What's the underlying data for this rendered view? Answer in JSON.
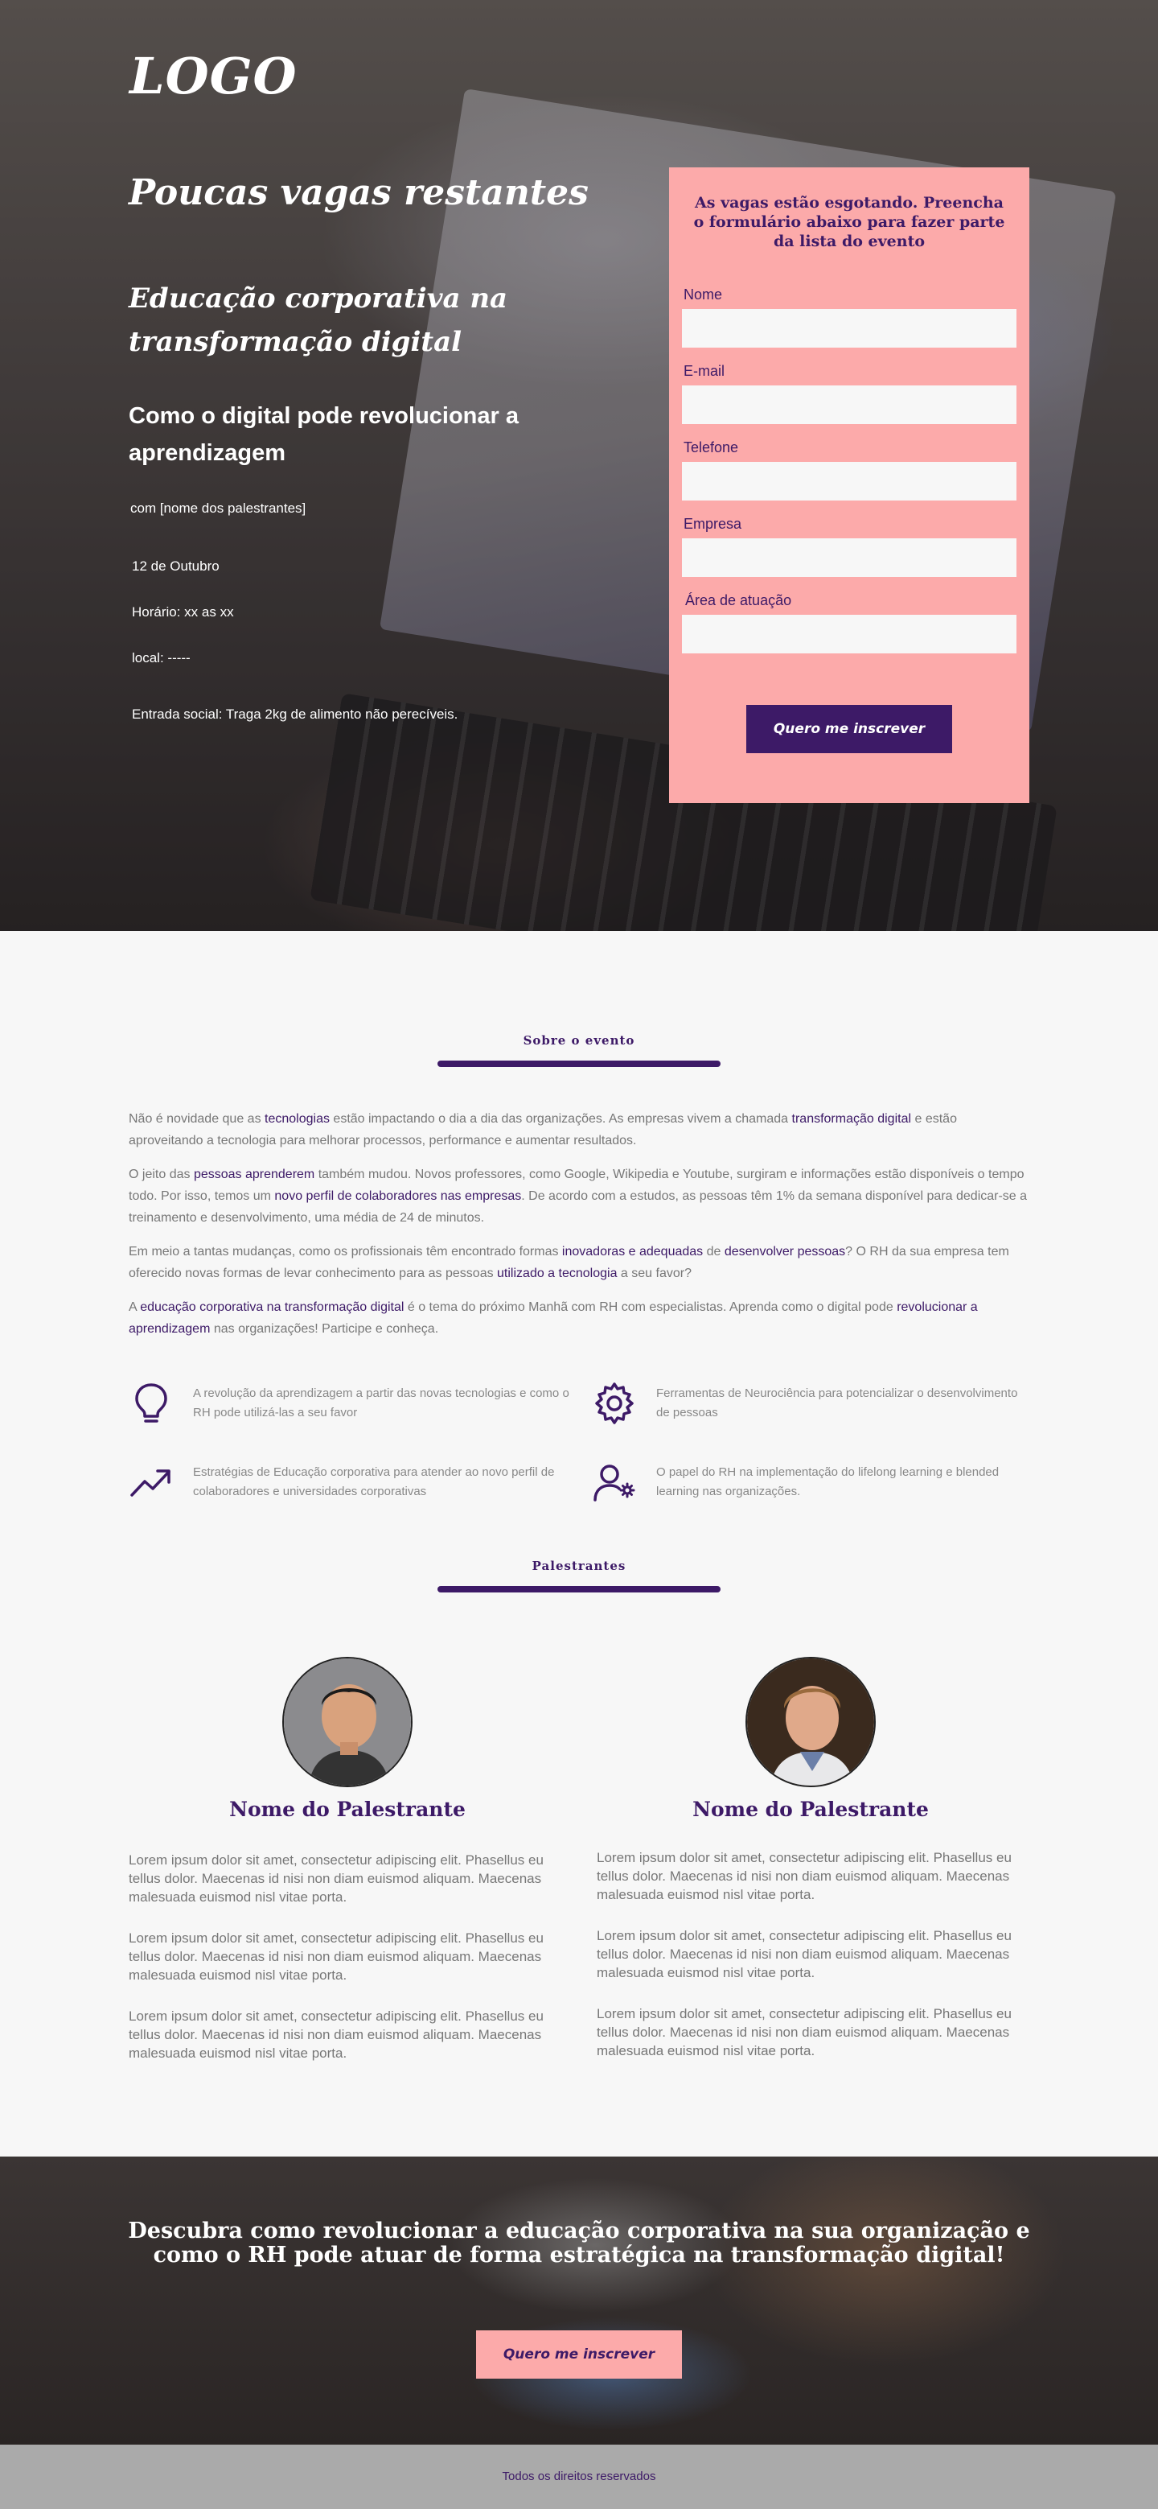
{
  "colors": {
    "primary": "#3d1a67",
    "accent": "#fcaaaa",
    "background": "#f7f7f7",
    "footer": "#aaaaaa"
  },
  "hero": {
    "logo": "LOGO",
    "title": "Poucas vagas restantes",
    "subtitle": "Educação corporativa na transformação digital",
    "subtitle2": "Como o digital pode revolucionar a aprendizagem",
    "speakers_line": "com [nome dos palestrantes]",
    "date": "12 de Outubro",
    "time": "Horário: xx as xx",
    "location": "local: -----",
    "entry": "Entrada social: Traga 2kg de alimento não perecíveis."
  },
  "form": {
    "title": "As vagas estão esgotando. Preencha o formulário abaixo para fazer parte da lista do evento",
    "fields": [
      {
        "label": "Nome",
        "value": ""
      },
      {
        "label": "E-mail",
        "value": ""
      },
      {
        "label": "Telefone",
        "value": ""
      },
      {
        "label": "Empresa",
        "value": ""
      },
      {
        "label": "Área de atuação",
        "value": ""
      }
    ],
    "submit": "Quero me inscrever"
  },
  "about": {
    "title": "Sobre o evento",
    "p1": [
      "Não é novidade que as ",
      "tecnologias",
      " estão impactando o dia a dia das organizações. As empresas vivem a chamada ",
      "transformação digital",
      " e estão aproveitando a tecnologia para melhorar processos, performance e aumentar resultados."
    ],
    "p2": [
      "O jeito das ",
      "pessoas aprenderem",
      " também mudou. Novos professores, como Google, Wikipedia e Youtube, surgiram e informações estão disponíveis o tempo todo. Por isso, temos um ",
      "novo perfil de colaboradores nas empresas",
      ". De acordo com a estudos, as pessoas têm 1% da semana disponível para dedicar-se a treinamento e desenvolvimento, uma média de 24 de minutos."
    ],
    "p3": [
      "Em meio a tantas mudanças, como os profissionais têm encontrado formas ",
      "inovadoras e adequadas",
      " de ",
      "desenvolver pessoas",
      "? O RH da sua empresa tem oferecido novas formas de levar conhecimento para as pessoas ",
      "utilizado a tecnologia",
      " a seu favor?"
    ],
    "p4": [
      "A ",
      "educação corporativa na transformação digital",
      " é o tema do próximo Manhã com RH com especialistas. Aprenda como o digital pode ",
      "revolucionar a aprendizagem",
      " nas organizações! Participe e conheça."
    ],
    "features": [
      {
        "icon": "lightbulb-icon",
        "text": "A revolução da aprendizagem a partir das novas tecnologias e como o RH pode utilizá-las a seu favor"
      },
      {
        "icon": "gear-icon",
        "text": "Ferramentas de Neurociência para potencializar o desenvolvimento de pessoas"
      },
      {
        "icon": "trending-up-icon",
        "text": "Estratégias de Educação corporativa para atender ao novo perfil de colaboradores e universidades corporativas"
      },
      {
        "icon": "user-settings-icon",
        "text": "O papel do RH na implementação do lifelong learning e blended learning nas organizações."
      }
    ]
  },
  "speakers": {
    "title": "Palestrantes",
    "items": [
      {
        "name": "Nome do Palestrante",
        "bio": [
          "Lorem ipsum dolor sit amet, consectetur adipiscing elit. Phasellus eu tellus dolor. Maecenas id nisi non diam euismod aliquam. Maecenas malesuada euismod nisl vitae porta.",
          "Lorem ipsum dolor sit amet, consectetur adipiscing elit. Phasellus eu tellus dolor. Maecenas id nisi non diam euismod aliquam. Maecenas malesuada euismod nisl vitae porta.",
          "Lorem ipsum dolor sit amet, consectetur adipiscing elit. Phasellus eu tellus dolor. Maecenas id nisi non diam euismod aliquam. Maecenas malesuada euismod nisl vitae porta."
        ]
      },
      {
        "name": "Nome do Palestrante",
        "bio": [
          "Lorem ipsum dolor sit amet, consectetur adipiscing elit. Phasellus eu tellus dolor. Maecenas id nisi non diam euismod aliquam. Maecenas malesuada euismod nisl vitae porta.",
          "Lorem ipsum dolor sit amet, consectetur adipiscing elit. Phasellus eu tellus dolor. Maecenas id nisi non diam euismod aliquam. Maecenas malesuada euismod nisl vitae porta.",
          "Lorem ipsum dolor sit amet, consectetur adipiscing elit. Phasellus eu tellus dolor. Maecenas id nisi non diam euismod aliquam. Maecenas malesuada euismod nisl vitae porta."
        ]
      }
    ]
  },
  "cta": {
    "title": "Descubra como revolucionar a educação corporativa na sua organização e como o RH pode atuar de forma estratégica na transformação digital!",
    "button": "Quero me inscrever"
  },
  "footer": {
    "text": "Todos os direitos reservados"
  }
}
